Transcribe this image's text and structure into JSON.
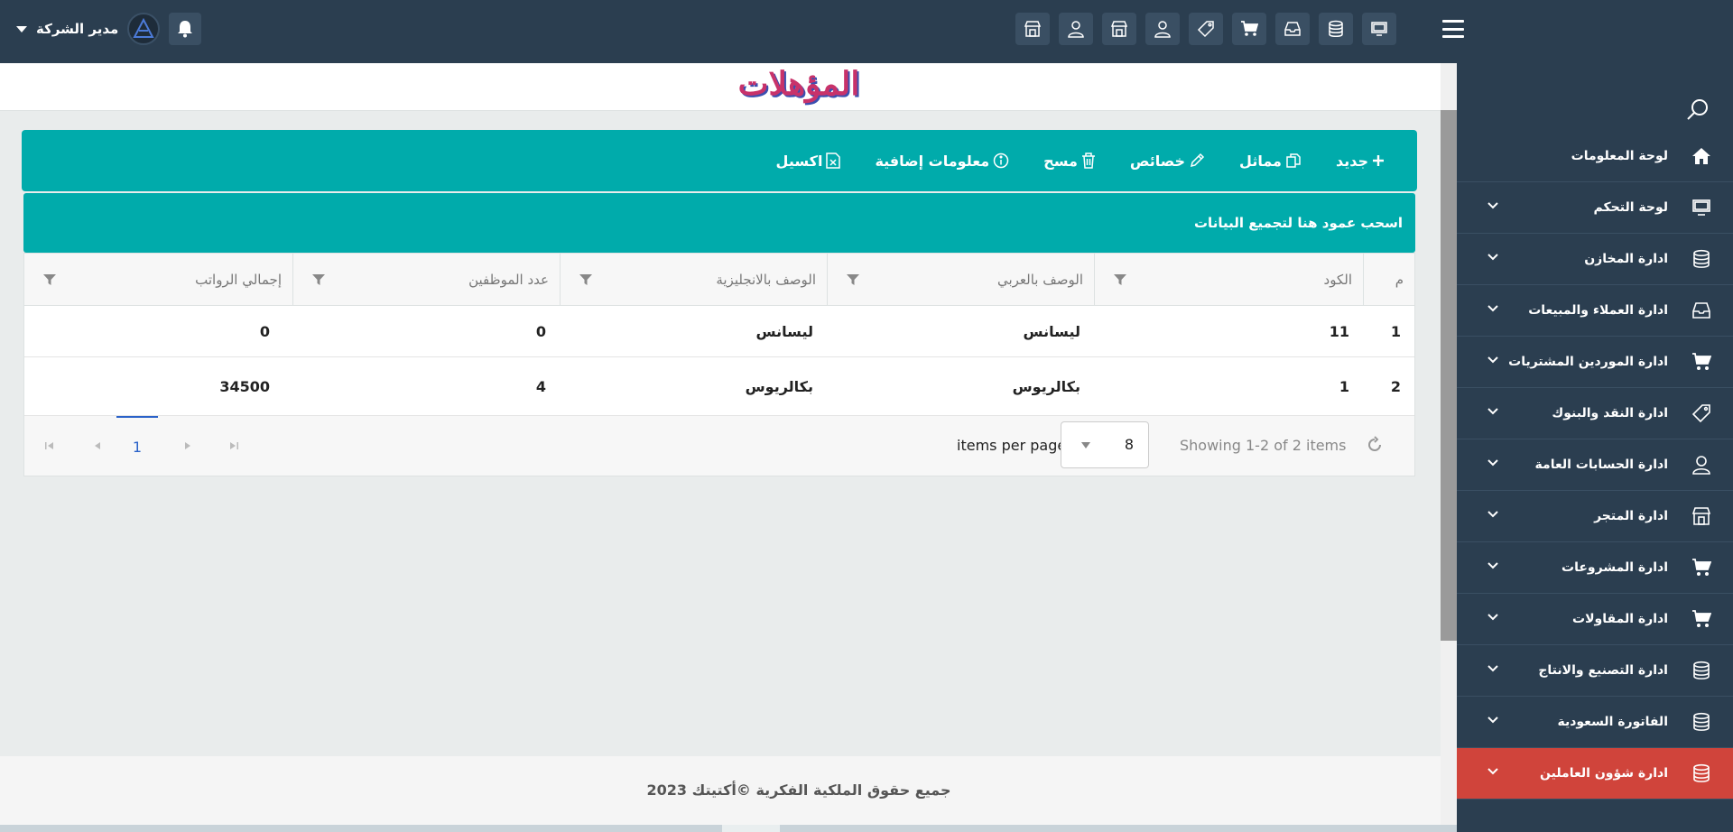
{
  "header": {
    "user_name": "مدير الشركة",
    "toolbar_icons": [
      "monitor-icon",
      "database-icon",
      "inbox-icon",
      "cart-icon",
      "tag-icon",
      "user-icon",
      "store-icon",
      "user-icon",
      "store-icon"
    ]
  },
  "page": {
    "title": "المؤهلات"
  },
  "actions": {
    "new": "جديد",
    "copy": "مماثل",
    "edit": "خصائص",
    "delete": "مسح",
    "info": "معلومات إضافية",
    "excel": "اكسيل"
  },
  "grid": {
    "group_hint": "اسحب عمود هنا لتجميع البيانات",
    "columns": [
      "م",
      "الكود",
      "الوصف بالعربي",
      "الوصف بالانجليزية",
      "عدد الموظفين",
      "إجمالي الرواتب"
    ],
    "rows": [
      {
        "no": "1",
        "code": "11",
        "name_ar": "ليسانس",
        "name_en": "ليسانس",
        "employees": "0",
        "salaries": "0"
      },
      {
        "no": "2",
        "code": "1",
        "name_ar": "بكالريوس",
        "name_en": "بكالريوس",
        "employees": "4",
        "salaries": "34500"
      }
    ],
    "pager": {
      "current_page": "1",
      "items_per_page_label": "items per page",
      "items_per_page": "8",
      "showing": "Showing 1-2 of 2 items"
    }
  },
  "footer": {
    "text": "جميع حقوق الملكية الفكرية ©أكتيتك 2023"
  },
  "sidebar": {
    "items": [
      {
        "label": "لوحة المعلومات",
        "icon": "home-icon"
      },
      {
        "label": "لوحة التحكم",
        "icon": "monitor-icon"
      },
      {
        "label": "ادارة المخازن",
        "icon": "database-icon"
      },
      {
        "label": "ادارة العملاء والمبيعات",
        "icon": "inbox-icon"
      },
      {
        "label": "ادارة الموردين المشتريات",
        "icon": "cart-icon"
      },
      {
        "label": "ادارة النقد والبنوك",
        "icon": "tag-icon"
      },
      {
        "label": "ادارة الحسابات العامة",
        "icon": "user-icon"
      },
      {
        "label": "ادارة المتجر",
        "icon": "store-icon"
      },
      {
        "label": "ادارة المشروعات",
        "icon": "cart-icon"
      },
      {
        "label": "ادارة المقاولات",
        "icon": "cart-icon"
      },
      {
        "label": "ادارة التصنيع والانتاج",
        "icon": "database-icon"
      },
      {
        "label": "الفاتورة السعودية",
        "icon": "database-icon"
      },
      {
        "label": "ادارة شؤون العاملين",
        "icon": "database-icon",
        "active": true
      }
    ]
  },
  "colors": {
    "header_bg": "#2b3e50",
    "accent_teal": "#00abab",
    "active_item": "#d0443b"
  }
}
